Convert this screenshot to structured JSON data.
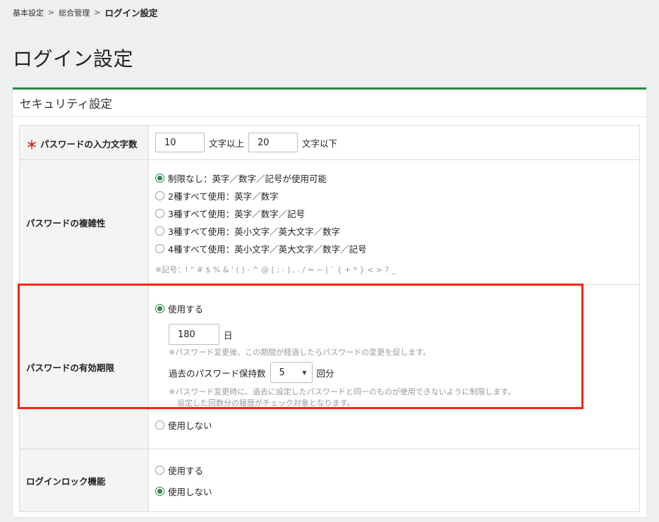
{
  "breadcrumb": {
    "items": [
      "基本設定",
      "総合管理"
    ],
    "separator": ">",
    "current": "ログイン設定"
  },
  "page_title": "ログイン設定",
  "panel": {
    "title": "セキュリティ設定"
  },
  "rows": {
    "password_length": {
      "required_mark": "＊",
      "label": "パスワードの入力文字数",
      "min_value": "10",
      "min_suffix": "文字以上",
      "max_value": "20",
      "max_suffix": "文字以下"
    },
    "complexity": {
      "label": "パスワードの複雑性",
      "options": [
        {
          "label": "制限なし：英字／数字／記号が使用可能",
          "checked": true
        },
        {
          "label": "2種すべて使用：英字／数字",
          "checked": false
        },
        {
          "label": "3種すべて使用：英字／数字／記号",
          "checked": false
        },
        {
          "label": "3種すべて使用：英小文字／英大文字／数字",
          "checked": false
        },
        {
          "label": "4種すべて使用：英小文字／英大文字／数字／記号",
          "checked": false
        }
      ],
      "note": "※記号：! \" # $ % & ' ( ) - ^ @ [ ; : ] , . / = ~ | ` { + * } < > ? _"
    },
    "expiration": {
      "label": "パスワードの有効期限",
      "use_label": "使用する",
      "days_value": "180",
      "days_unit": "日",
      "days_note": "※パスワード変更後、この期間が経過したらパスワードの変更を促します。",
      "history_label": "過去のパスワード保持数",
      "history_value": "5",
      "history_unit": "回分",
      "history_note_1": "※パスワード変更時に、過去に設定したパスワードと同一のものが使用できないように制限します。",
      "history_note_2": "設定した回数分の履歴がチェック対象となります。",
      "not_use_label": "使用しない",
      "selected": "use"
    },
    "login_lock": {
      "label": "ログインロック機能",
      "use_label": "使用する",
      "not_use_label": "使用しない",
      "selected": "not_use"
    }
  },
  "colors": {
    "accent": "#2a8a4a",
    "highlight_border": "#f2260e",
    "required": "#e02020"
  }
}
